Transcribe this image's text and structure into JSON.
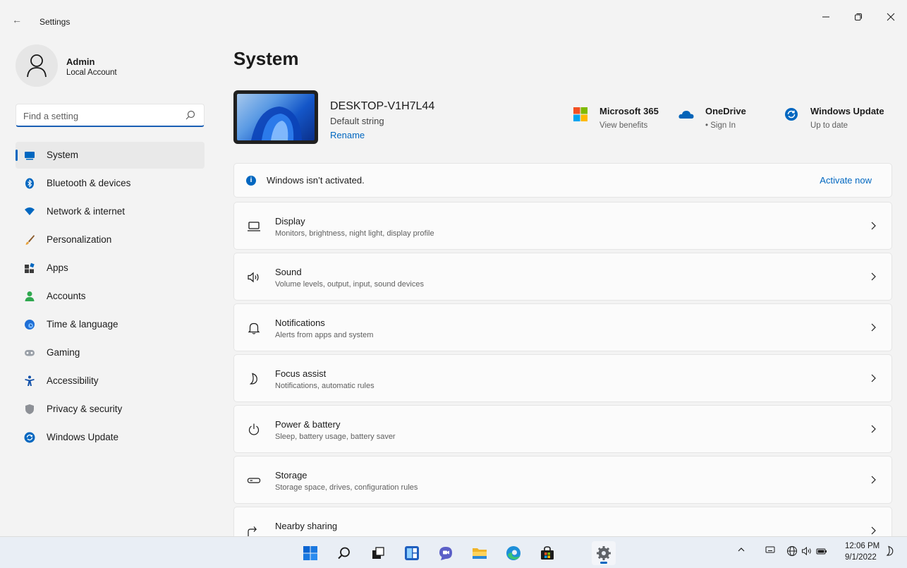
{
  "titlebar": {
    "title": "Settings"
  },
  "profile": {
    "name": "Admin",
    "account_type": "Local Account"
  },
  "search": {
    "placeholder": "Find a setting"
  },
  "nav": [
    {
      "label": "System",
      "icon": "monitor-icon",
      "active": true
    },
    {
      "label": "Bluetooth & devices",
      "icon": "bluetooth-icon"
    },
    {
      "label": "Network & internet",
      "icon": "wifi-icon"
    },
    {
      "label": "Personalization",
      "icon": "brush-icon"
    },
    {
      "label": "Apps",
      "icon": "apps-icon"
    },
    {
      "label": "Accounts",
      "icon": "person-icon"
    },
    {
      "label": "Time & language",
      "icon": "clock-globe-icon"
    },
    {
      "label": "Gaming",
      "icon": "gamepad-icon"
    },
    {
      "label": "Accessibility",
      "icon": "accessibility-icon"
    },
    {
      "label": "Privacy & security",
      "icon": "shield-icon"
    },
    {
      "label": "Windows Update",
      "icon": "update-icon"
    }
  ],
  "page": {
    "title": "System"
  },
  "device": {
    "name": "DESKTOP-V1H7L44",
    "subtitle": "Default string",
    "rename": "Rename"
  },
  "quick_links": [
    {
      "title": "Microsoft 365",
      "subtitle": "View benefits",
      "icon": "microsoft-logo-icon"
    },
    {
      "title": "OneDrive",
      "subtitle": "• Sign In",
      "icon": "cloud-icon"
    },
    {
      "title": "Windows Update",
      "subtitle": "Up to date",
      "icon": "refresh-icon"
    }
  ],
  "activation": {
    "message": "Windows isn’t activated.",
    "action": "Activate now"
  },
  "settings": [
    {
      "title": "Display",
      "subtitle": "Monitors, brightness, night light, display profile",
      "icon": "laptop-icon"
    },
    {
      "title": "Sound",
      "subtitle": "Volume levels, output, input, sound devices",
      "icon": "speaker-icon"
    },
    {
      "title": "Notifications",
      "subtitle": "Alerts from apps and system",
      "icon": "bell-icon"
    },
    {
      "title": "Focus assist",
      "subtitle": "Notifications, automatic rules",
      "icon": "moon-icon"
    },
    {
      "title": "Power & battery",
      "subtitle": "Sleep, battery usage, battery saver",
      "icon": "power-icon"
    },
    {
      "title": "Storage",
      "subtitle": "Storage space, drives, configuration rules",
      "icon": "drive-icon"
    },
    {
      "title": "Nearby sharing",
      "subtitle": "",
      "icon": "share-icon"
    }
  ],
  "taskbar": {
    "apps": [
      "start-icon",
      "search-icon",
      "task-view-icon",
      "widgets-icon",
      "teams-chat-icon",
      "file-explorer-icon",
      "edge-icon",
      "store-icon",
      "settings-gear-icon"
    ],
    "clock_time": "12:06 PM",
    "clock_date": "9/1/2022"
  },
  "colors": {
    "accent": "#0067c0",
    "background": "#f3f3f3",
    "card": "#fbfbfb"
  }
}
